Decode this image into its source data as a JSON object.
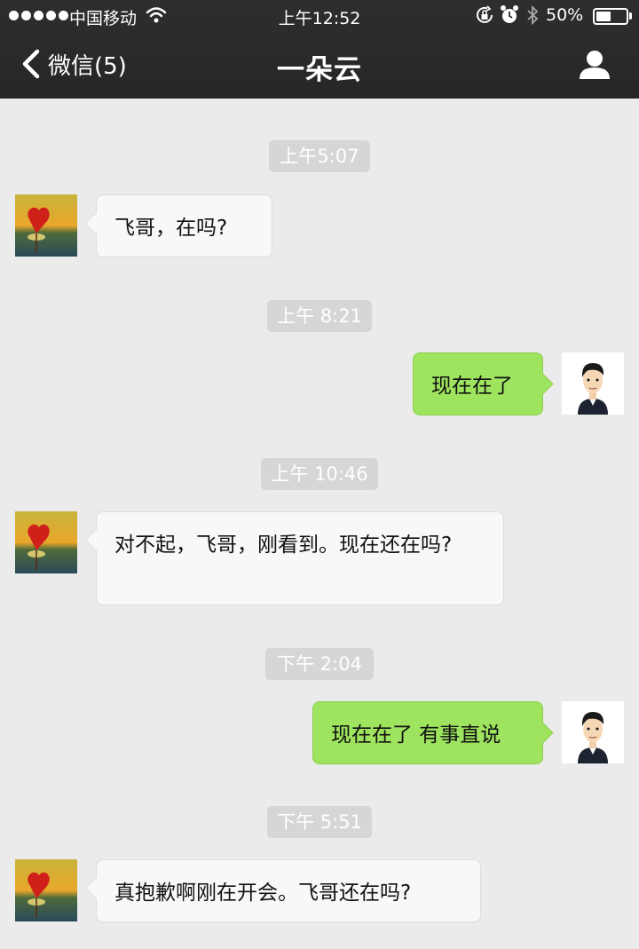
{
  "status_bar": {
    "carrier": "中国移动",
    "time": "上午12:52",
    "battery_percent": "50%",
    "battery_level": 0.5,
    "signal_icon": "signal-dots-icon",
    "wifi_icon": "wifi-icon",
    "rotation_lock_icon": "rotation-lock-icon",
    "alarm_icon": "alarm-icon",
    "bluetooth_icon": "bluetooth-icon"
  },
  "nav": {
    "back_label": "微信(5)",
    "title": "一朵云",
    "back_icon": "chevron-left-icon",
    "profile_icon": "person-icon"
  },
  "colors": {
    "header_bg": "#2b2b2d",
    "chat_bg": "#ebebeb",
    "incoming_bubble": "#f8f8f8",
    "outgoing_bubble": "#9ee45f",
    "timestamp_bg": "#d6d6d6"
  },
  "messages": [
    {
      "timestamp": "上午5:07",
      "direction": "incoming",
      "text": "飞哥，在吗?"
    },
    {
      "timestamp": "上午 8:21",
      "direction": "outgoing",
      "text": "现在在了"
    },
    {
      "timestamp": "上午 10:46",
      "direction": "incoming",
      "text": "对不起，飞哥，刚看到。现在还在吗?"
    },
    {
      "timestamp": "下午 2:04",
      "direction": "outgoing",
      "text": "现在在了 有事直说"
    },
    {
      "timestamp": "下午 5:51",
      "direction": "incoming",
      "text": "真抱歉啊刚在开会。飞哥还在吗?"
    }
  ]
}
